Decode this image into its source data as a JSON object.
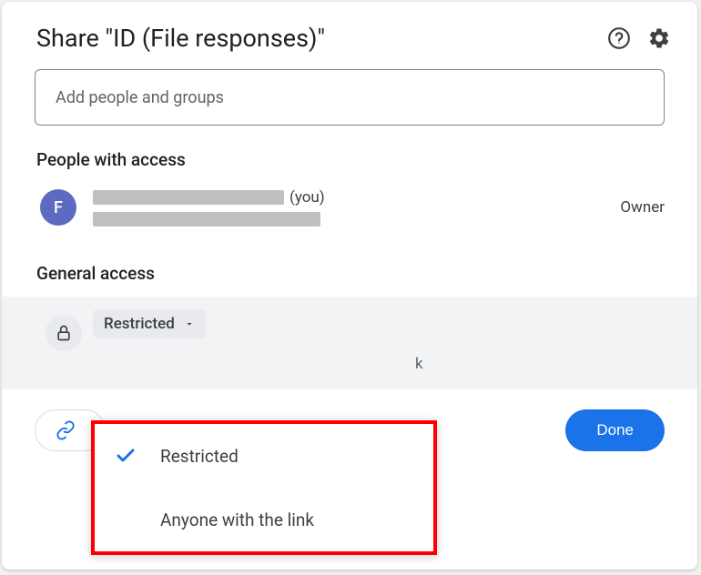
{
  "header": {
    "title": "Share \"ID (File responses)\""
  },
  "addInput": {
    "placeholder": "Add people and groups"
  },
  "peopleSection": {
    "title": "People with access",
    "person": {
      "avatarLetter": "F",
      "youSuffix": "(you)",
      "role": "Owner"
    }
  },
  "generalSection": {
    "title": "General access",
    "selected": "Restricted",
    "descFragment": "k",
    "options": {
      "restricted": "Restricted",
      "anyone": "Anyone with the link"
    }
  },
  "footer": {
    "copyLink": "",
    "done": "Done"
  }
}
